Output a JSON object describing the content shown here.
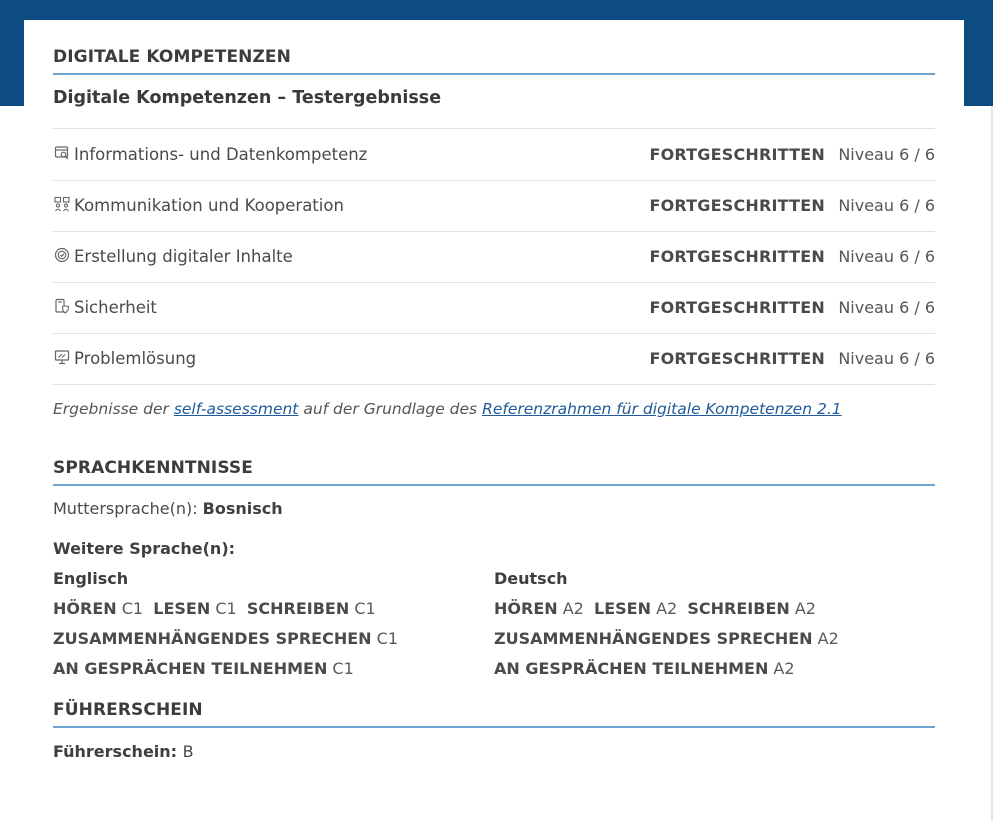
{
  "digital": {
    "heading": "DIGITALE KOMPETENZEN",
    "subheading": "Digitale Kompetenzen – Testergebnisse",
    "rows": [
      {
        "icon": "data-search-icon",
        "name": "Informations- und Datenkompetenz",
        "level": "FORTGESCHRITTEN",
        "niveau": "Niveau 6 / 6"
      },
      {
        "icon": "people-network-icon",
        "name": "Kommunikation und Kooperation",
        "level": "FORTGESCHRITTEN",
        "niveau": "Niveau 6 / 6"
      },
      {
        "icon": "content-creation-icon",
        "name": "Erstellung digitaler Inhalte",
        "level": "FORTGESCHRITTEN",
        "niveau": "Niveau 6 / 6"
      },
      {
        "icon": "security-icon",
        "name": "Sicherheit",
        "level": "FORTGESCHRITTEN",
        "niveau": "Niveau 6 / 6"
      },
      {
        "icon": "monitor-tools-icon",
        "name": "Problemlösung",
        "level": "FORTGESCHRITTEN",
        "niveau": "Niveau 6 / 6"
      }
    ],
    "footnote_pre": "Ergebnisse der ",
    "footnote_link1": "self-assessment",
    "footnote_mid": " auf der Grundlage des ",
    "footnote_link2": "Referenzrahmen für digitale Kompetenzen 2.1"
  },
  "languages": {
    "heading": "SPRACHKENNTNISSE",
    "mother_label": "Muttersprache(n): ",
    "mother_value": "Bosnisch",
    "other_label": "Weitere Sprache(n):",
    "labels": {
      "hoeren": "HÖREN",
      "lesen": "LESEN",
      "schreiben": "SCHREIBEN",
      "sprechen": "ZUSAMMENHÄNGENDES SPRECHEN",
      "teilnehmen": "AN GESPRÄCHEN TEILNEHMEN"
    },
    "items": [
      {
        "name": "Englisch",
        "hoeren": "C1",
        "lesen": "C1",
        "schreiben": "C1",
        "sprechen": "C1",
        "teilnehmen": "C1"
      },
      {
        "name": "Deutsch",
        "hoeren": "A2",
        "lesen": "A2",
        "schreiben": "A2",
        "sprechen": "A2",
        "teilnehmen": "A2"
      }
    ]
  },
  "license": {
    "heading": "FÜHRERSCHEIN",
    "label": "Führerschein: ",
    "value": "B"
  },
  "colors": {
    "header_band": "#0c4c82",
    "heading_rule": "#6ea3d4",
    "link": "#1f5a9a"
  }
}
